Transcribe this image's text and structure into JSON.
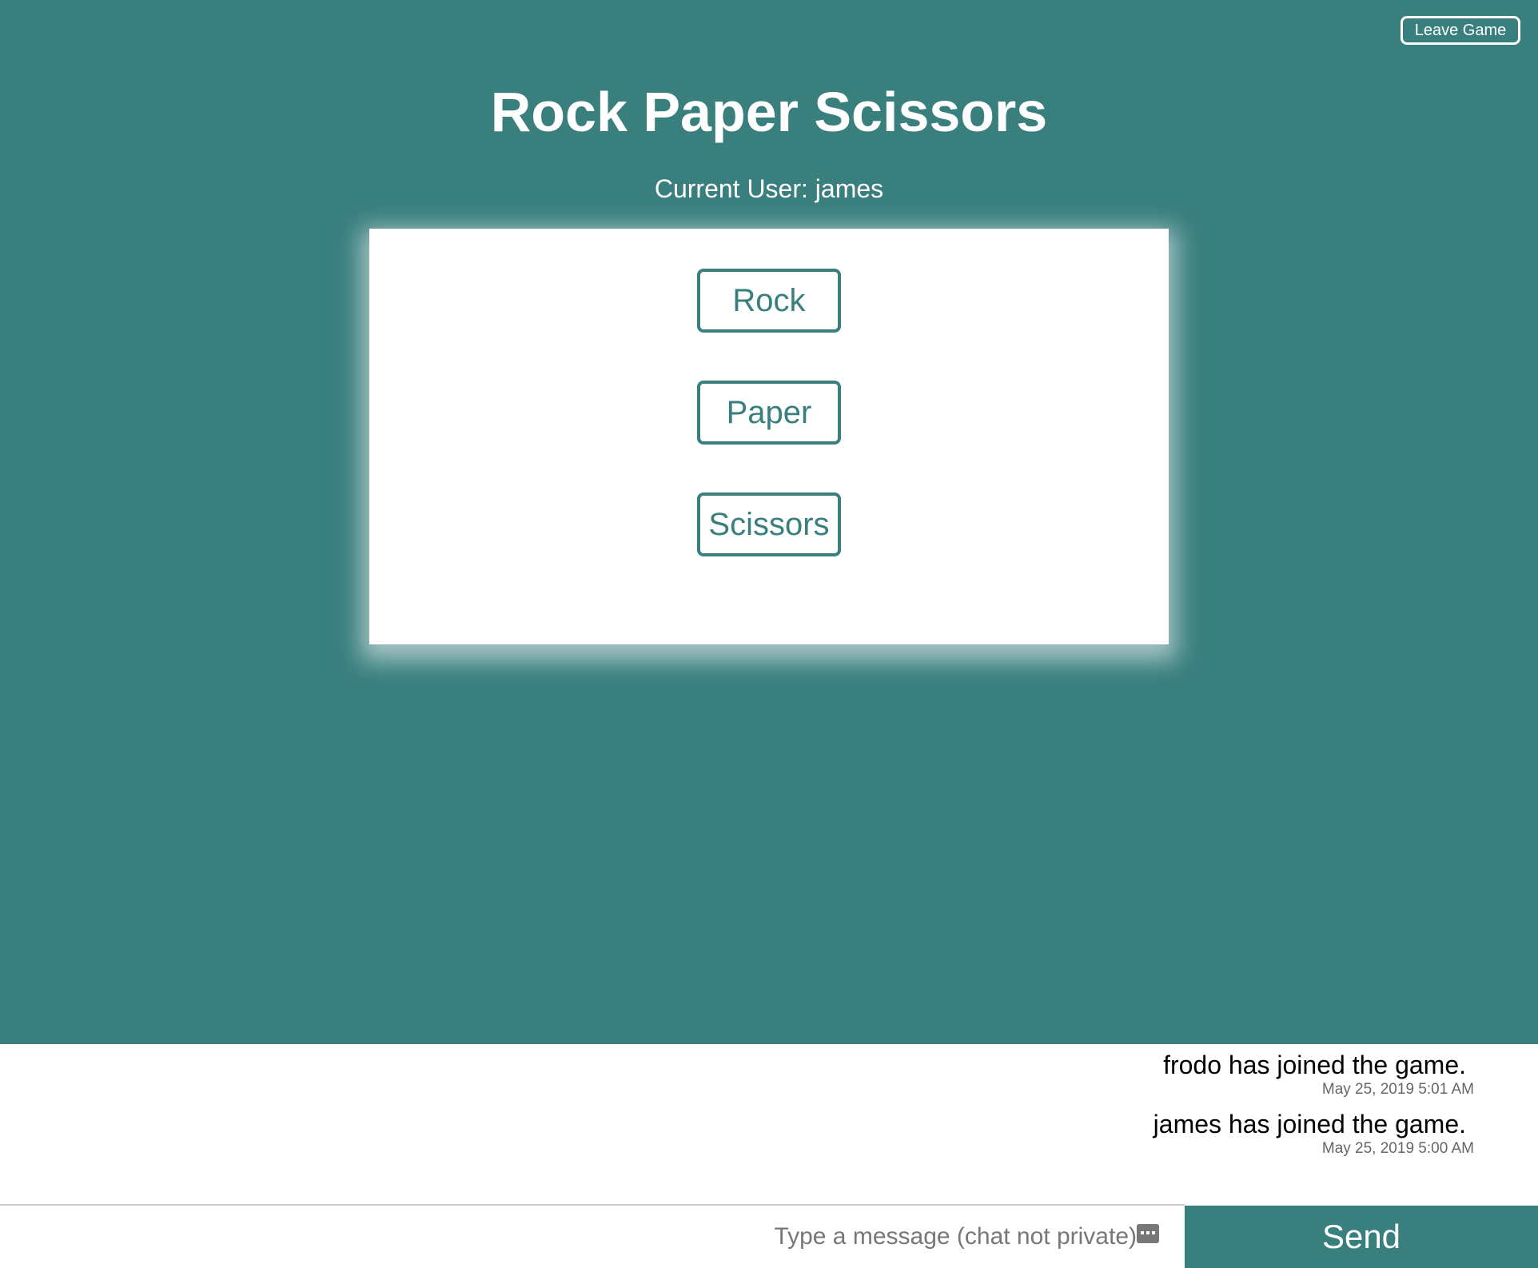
{
  "header": {
    "leave_label": "Leave Game",
    "title": "Rock Paper Scissors",
    "current_user": "Current User: james"
  },
  "choices": [
    {
      "label": "Rock"
    },
    {
      "label": "Paper"
    },
    {
      "label": "Scissors"
    }
  ],
  "chat": {
    "messages": [
      {
        "text": "frodo has joined the game.",
        "time": "May 25, 2019 5:01 AM"
      },
      {
        "text": "james has joined the game.",
        "time": "May 25, 2019 5:00 AM"
      }
    ],
    "input_placeholder": "Type a message (chat not private)",
    "input_value": "",
    "send_label": "Send"
  },
  "colors": {
    "accent": "#397f7e",
    "background": "#ffffff"
  },
  "icons": {
    "input_addon": "keyboard-icon"
  }
}
